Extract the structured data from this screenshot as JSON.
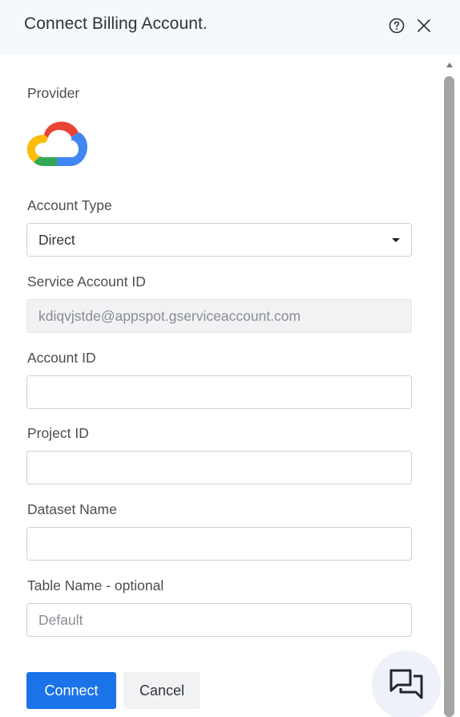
{
  "dialog": {
    "title": "Connect Billing Account."
  },
  "icons": {
    "help": "help-circle-icon",
    "close": "close-icon",
    "provider_logo": "google-cloud-logo",
    "chat": "chat-bubbles-icon"
  },
  "form": {
    "provider_label": "Provider",
    "account_type_label": "Account Type",
    "account_type_value": "Direct",
    "service_account_label": "Service Account ID",
    "service_account_value": "kdiqvjstde@appspot.gserviceaccount.com",
    "account_id_label": "Account ID",
    "account_id_value": "",
    "project_id_label": "Project ID",
    "project_id_value": "",
    "dataset_name_label": "Dataset Name",
    "dataset_name_value": "",
    "table_name_label": "Table Name - optional",
    "table_name_placeholder": "Default"
  },
  "buttons": {
    "connect": "Connect",
    "cancel": "Cancel"
  },
  "colors": {
    "primary": "#1a73e8",
    "header_bg": "#f5f8fd"
  }
}
